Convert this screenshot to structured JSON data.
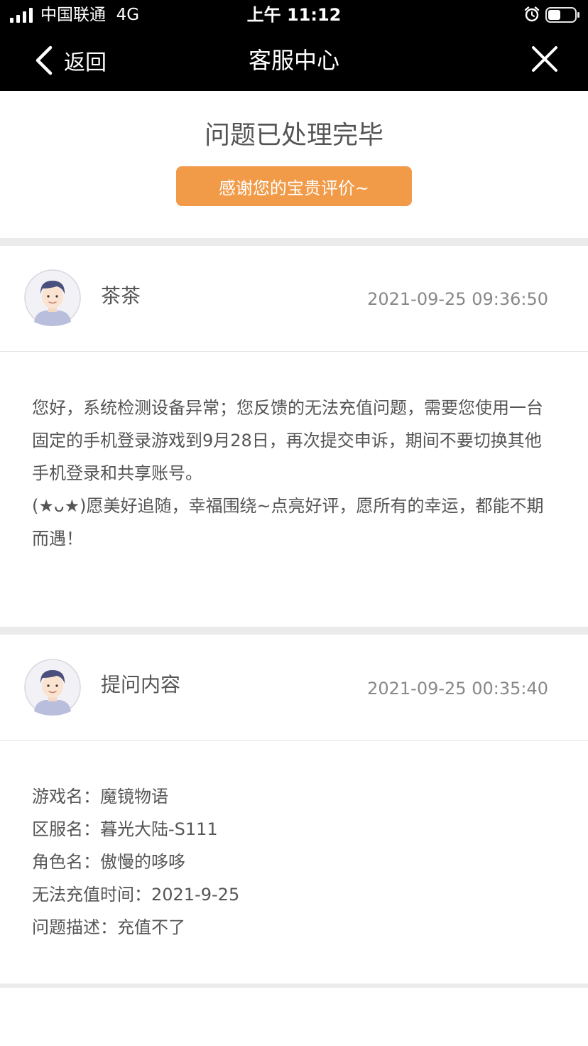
{
  "status_bar": {
    "carrier": "中国联通",
    "network": "4G",
    "time": "上午 11:12"
  },
  "nav": {
    "back_label": "返回",
    "title": "客服中心",
    "icons": [
      "chevron-left-icon",
      "close-icon"
    ]
  },
  "status": {
    "title": "问题已处理完毕",
    "rate_button": "感谢您的宝贵评价~",
    "accent_color": "#F19A47"
  },
  "reply": {
    "author": "茶茶",
    "timestamp": "2021-09-25 09:36:50",
    "paragraphs": [
      "您好，系统检测设备异常；您反馈的无法充值问题，需要您使用一台固定的手机登录游戏到9月28日，再次提交申诉，期间不要切换其他手机登录和共享账号。",
      "(★ᴗ★)愿美好追随，幸福围绕~点亮好评，愿所有的幸运，都能不期而遇！"
    ]
  },
  "question": {
    "title": "提问内容",
    "timestamp": "2021-09-25 00:35:40",
    "rows": [
      {
        "label": "游戏名：",
        "value": "魔镜物语"
      },
      {
        "label": "区服名：",
        "value": "暮光大陆-S111"
      },
      {
        "label": "角色名：",
        "value": "傲慢的哆哆"
      },
      {
        "label": "无法充值时间：",
        "value": "2021-9-25"
      },
      {
        "label": "问题描述：",
        "value": "充值不了"
      }
    ]
  }
}
